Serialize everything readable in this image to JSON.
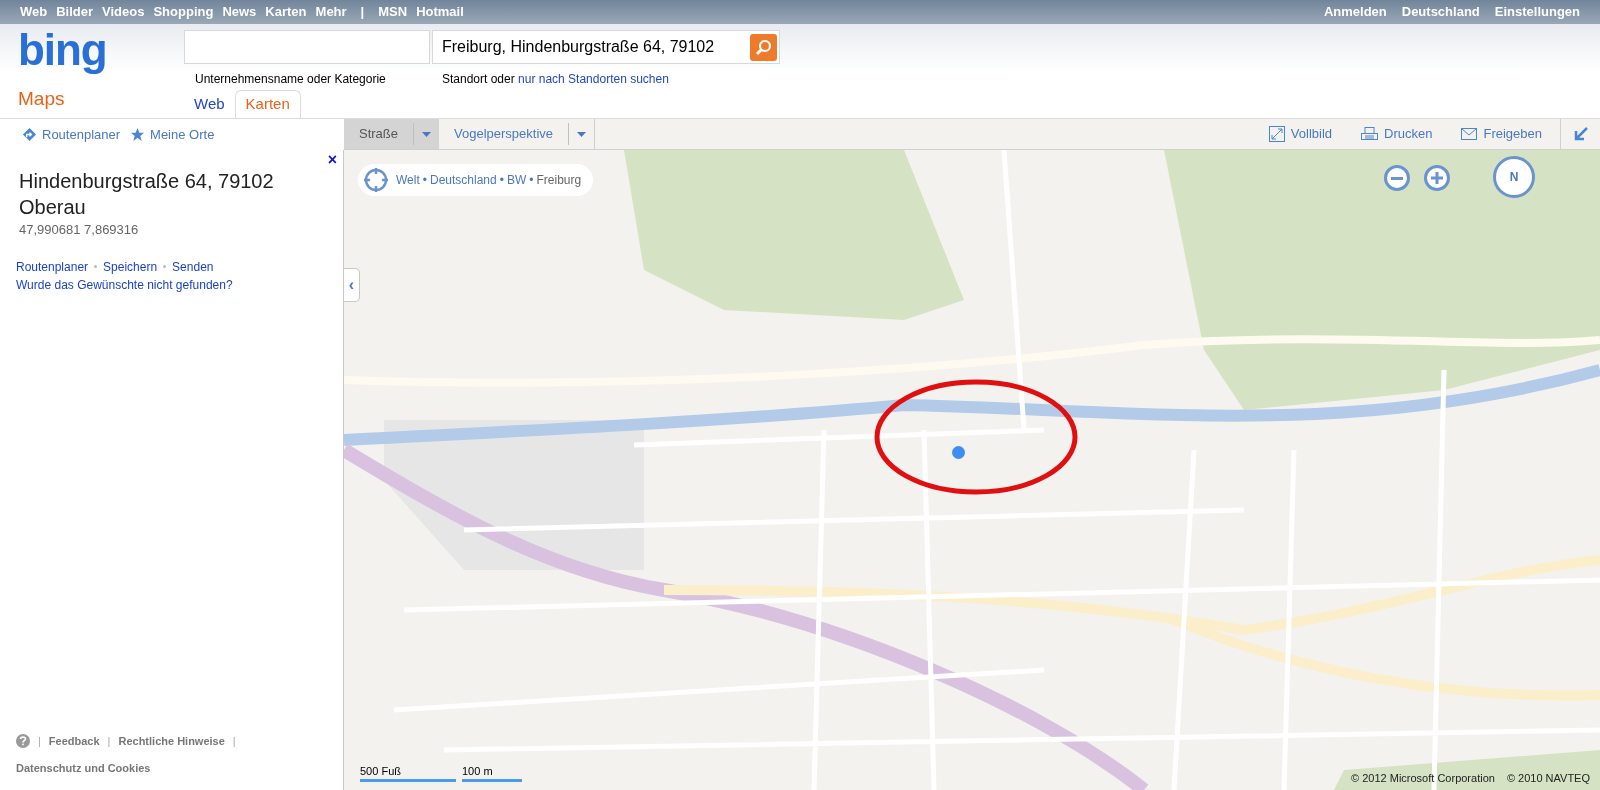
{
  "top_nav": {
    "left": [
      {
        "kind": "link",
        "label": "Web"
      },
      {
        "kind": "link",
        "label": "Bilder"
      },
      {
        "kind": "link",
        "label": "Videos"
      },
      {
        "kind": "link",
        "label": "Shopping"
      },
      {
        "kind": "link",
        "label": "News"
      },
      {
        "kind": "link",
        "label": "Karten"
      },
      {
        "kind": "link",
        "label": "Mehr"
      },
      {
        "kind": "separator",
        "label": "|"
      },
      {
        "kind": "link",
        "label": "MSN"
      },
      {
        "kind": "link",
        "label": "Hotmail"
      }
    ],
    "right": [
      "Anmelden",
      "Deutschland",
      "Einstellungen"
    ]
  },
  "logo": "bing",
  "section": "Maps",
  "search": {
    "business_label": "Unternehmensname oder Kategorie",
    "location_value": "Freiburg, Hindenburgstraße 64, 79102",
    "location_label": "Standort oder ",
    "location_link": "nur nach Standorten suchen"
  },
  "tabs": [
    {
      "label": "Web",
      "selected": false
    },
    {
      "label": "Karten",
      "selected": true
    }
  ],
  "panel_toolbar": [
    {
      "kind": "route",
      "label": "Routenplaner"
    },
    {
      "kind": "star",
      "label": "Meine Orte"
    }
  ],
  "map_views": [
    {
      "label": "Straße",
      "selected": true
    },
    {
      "label": "Vogelperspektive",
      "selected": false
    }
  ],
  "map_actions": [
    {
      "kind": "fullscreen",
      "label": "Vollbild"
    },
    {
      "kind": "print",
      "label": "Drucken"
    },
    {
      "kind": "share",
      "label": "Freigeben"
    }
  ],
  "result": {
    "close": "×",
    "title": "Hindenburgstraße 64, 79102",
    "subtitle": "Oberau",
    "coordinates": "47,990681 7,869316",
    "actions": [
      "Routenplaner",
      "Speichern",
      "Senden"
    ],
    "not_found_link": "Wurde das Gewünschte nicht gefunden?"
  },
  "footer": {
    "row": [
      {
        "kind": "separator",
        "label": "|"
      },
      {
        "kind": "link",
        "label": "Feedback"
      },
      {
        "kind": "separator",
        "label": "|"
      },
      {
        "kind": "link",
        "label": "Rechtliche Hinweise"
      },
      {
        "kind": "separator",
        "label": "|"
      }
    ],
    "privacy": "Datenschutz und Cookies"
  },
  "collapse": "‹",
  "breadcrumb": [
    {
      "kind": "link",
      "label": "Welt"
    },
    {
      "kind": "separator",
      "label": "•"
    },
    {
      "kind": "link",
      "label": "Deutschland"
    },
    {
      "kind": "separator",
      "label": "•"
    },
    {
      "kind": "link",
      "label": "BW"
    },
    {
      "kind": "separator",
      "label": "•"
    },
    {
      "kind": "current",
      "label": "Freiburg"
    }
  ],
  "compass": "N",
  "scale": [
    "500 Fuß",
    "100 m"
  ],
  "copyright": [
    "© 2012 Microsoft Corporation",
    "© 2010 NAVTEQ"
  ]
}
